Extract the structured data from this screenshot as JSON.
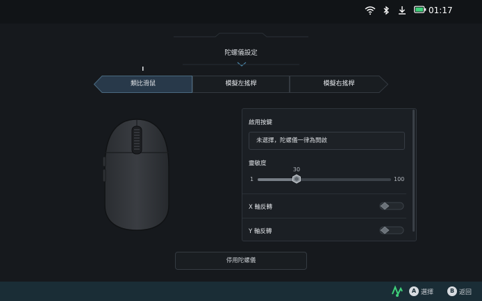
{
  "status_bar": {
    "time": "01:17",
    "icons": [
      "wifi-icon",
      "bluetooth-icon",
      "download-icon",
      "battery-icon"
    ]
  },
  "header": {
    "section_title": "陀螺儀設定"
  },
  "tabs": [
    {
      "label": "類比滑鼠",
      "active": true
    },
    {
      "label": "模擬左搖桿",
      "active": false
    },
    {
      "label": "模擬右搖桿",
      "active": false
    }
  ],
  "settings": {
    "enable_key_label": "啟用按鍵",
    "enable_key_value": "未選擇，陀螺儀一律為開啟",
    "sensitivity_label": "靈敏度",
    "sensitivity_value": "30",
    "sensitivity_min": "1",
    "sensitivity_max": "100",
    "sensitivity_fraction": 0.293,
    "x_invert_label": "X 軸反轉",
    "x_invert_on": false,
    "y_invert_label": "Y 軸反轉",
    "y_invert_on": false
  },
  "disable_button_label": "停用陀螺儀",
  "footer": {
    "confirm_key": "A",
    "confirm_label": "選擇",
    "back_key": "B",
    "back_label": "返回"
  },
  "colors": {
    "active_tab": "#2a3e4c",
    "accent_footer": "#1a2d36",
    "logo_green": "#3fd07a"
  }
}
